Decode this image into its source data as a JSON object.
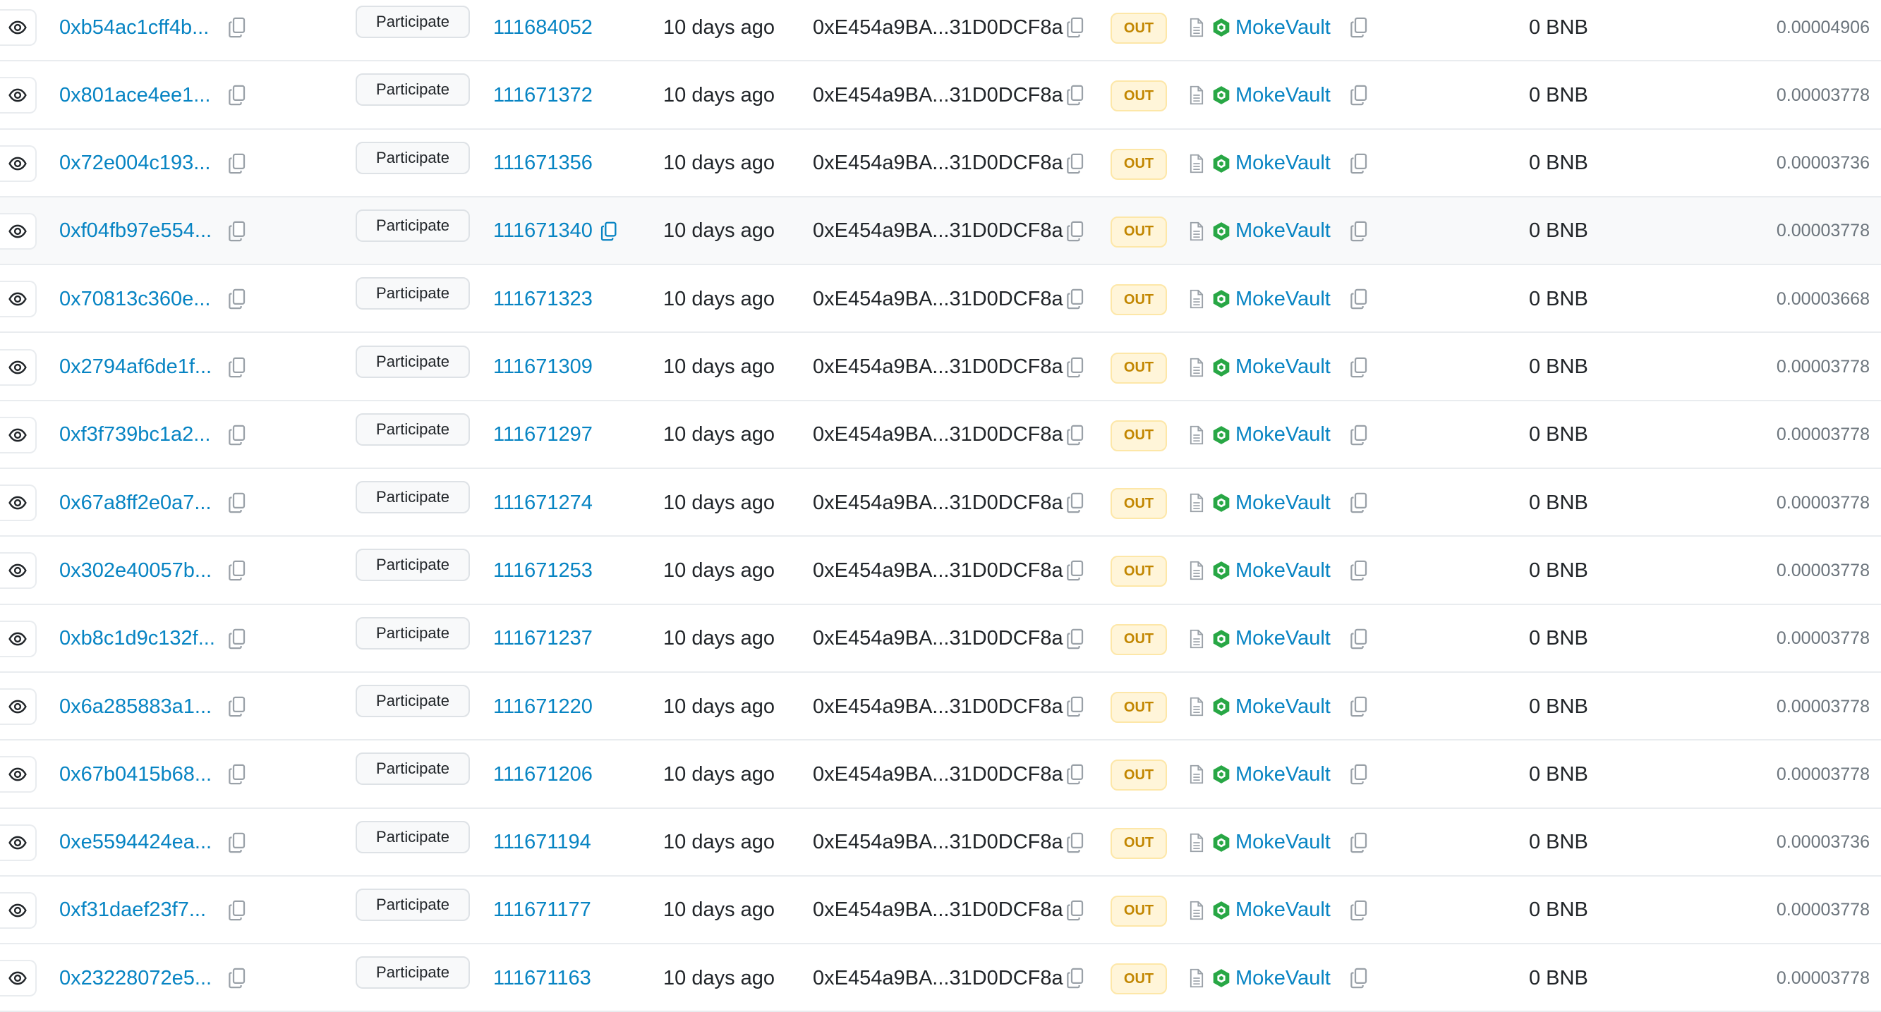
{
  "common": {
    "method": "Participate",
    "age": "10 days ago",
    "from": "0xE454a9BA...31D0DCF8a",
    "direction": "OUT",
    "to": "MokeVault",
    "value": "0 BNB"
  },
  "colors": {
    "link": "#0784c3",
    "text": "#212529",
    "muted": "#6c757d",
    "out_badge_bg": "#fff5d9",
    "out_badge_text": "#c28600",
    "contract_icon": "#28a745"
  },
  "icons": [
    "eye-icon",
    "copy-icon",
    "contract-document-icon",
    "verified-contract-hex-icon"
  ],
  "rows": [
    {
      "hash": "0xb54ac1cff4b...",
      "block": "111684052",
      "fee": "0.00004906"
    },
    {
      "hash": "0x801ace4ee1...",
      "block": "111671372",
      "fee": "0.00003778"
    },
    {
      "hash": "0x72e004c193...",
      "block": "111671356",
      "fee": "0.00003736"
    },
    {
      "hash": "0xf04fb97e554...",
      "block": "111671340",
      "fee": "0.00003778"
    },
    {
      "hash": "0x70813c360e...",
      "block": "111671323",
      "fee": "0.00003668"
    },
    {
      "hash": "0x2794af6de1f...",
      "block": "111671309",
      "fee": "0.00003778"
    },
    {
      "hash": "0xf3f739bc1a2...",
      "block": "111671297",
      "fee": "0.00003778"
    },
    {
      "hash": "0x67a8ff2e0a7...",
      "block": "111671274",
      "fee": "0.00003778"
    },
    {
      "hash": "0x302e40057b...",
      "block": "111671253",
      "fee": "0.00003778"
    },
    {
      "hash": "0xb8c1d9c132f...",
      "block": "111671237",
      "fee": "0.00003778"
    },
    {
      "hash": "0x6a285883a1...",
      "block": "111671220",
      "fee": "0.00003778"
    },
    {
      "hash": "0x67b0415b68...",
      "block": "111671206",
      "fee": "0.00003778"
    },
    {
      "hash": "0xe5594424ea...",
      "block": "111671194",
      "fee": "0.00003736"
    },
    {
      "hash": "0xf31daef23f7...",
      "block": "111671177",
      "fee": "0.00003778"
    },
    {
      "hash": "0x23228072e5...",
      "block": "111671163",
      "fee": "0.00003778"
    }
  ]
}
